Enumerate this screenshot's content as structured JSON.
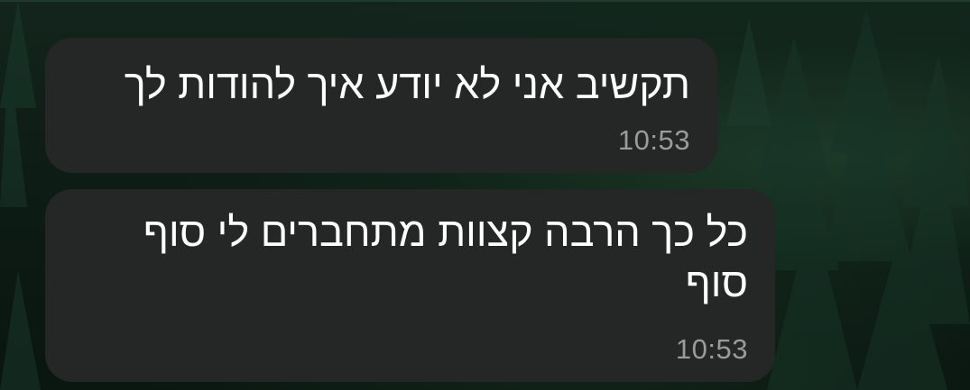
{
  "chat": {
    "messages": [
      {
        "text": "תקשיב אני לא יודע איך להודות לך",
        "time": "10:53"
      },
      {
        "text": "כל כך הרבה קצוות מתחברים לי סוף סוף",
        "time": "10:53"
      }
    ]
  },
  "colors": {
    "bubble_background": "#252626",
    "message_text": "#ffffff",
    "timestamp_text": "#9a9b9c",
    "wallpaper_base": "#0c1a14"
  }
}
